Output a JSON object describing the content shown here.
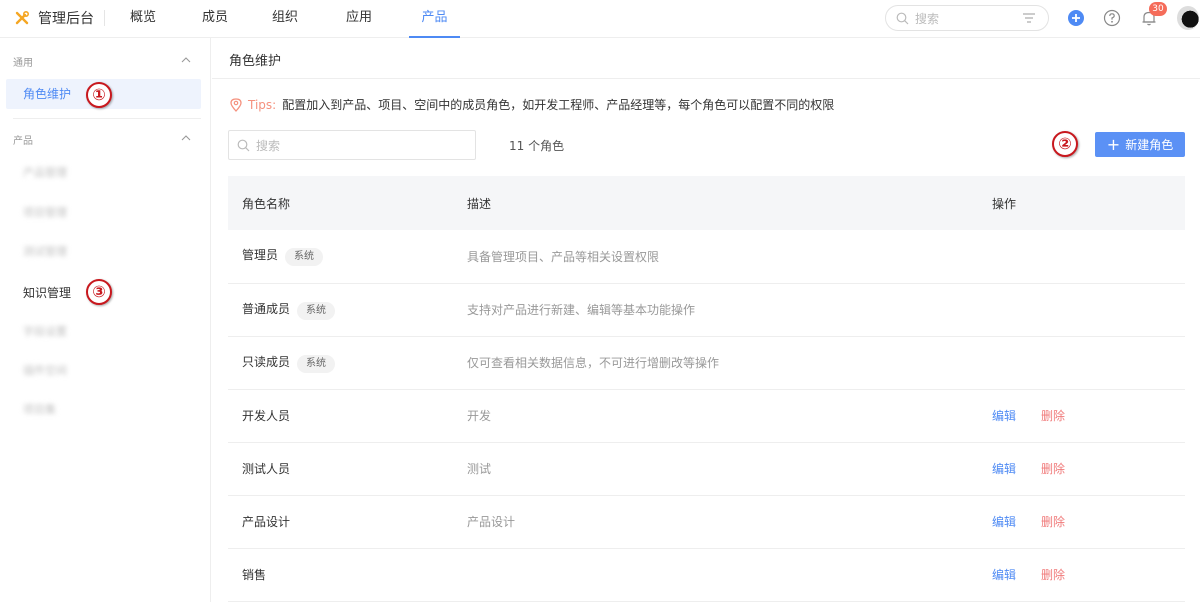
{
  "topbar": {
    "app_title": "管理后台",
    "nav": [
      "概览",
      "成员",
      "组织",
      "应用",
      "产品"
    ],
    "active_nav": "产品",
    "search_placeholder": "搜索",
    "notification_count": "30",
    "icons": [
      "tools-icon",
      "filter-icon",
      "add-circle-icon",
      "help-icon",
      "bell-icon"
    ]
  },
  "sidebar": {
    "group1_title": "通用",
    "group1_items": [
      "角色维护"
    ],
    "group2_title": "产品",
    "group2_items": [
      "产品管理",
      "项目管理",
      "测试管理",
      "知识管理",
      "字段设置",
      "插件空间",
      "项目集"
    ],
    "annotations": [
      "①",
      "②",
      "③"
    ]
  },
  "main": {
    "title": "角色维护",
    "tips_label": "Tips:",
    "tips_text": "配置加入到产品、项目、空间中的成员角色，如开发工程师、产品经理等，每个角色可以配置不同的权限",
    "search_placeholder": "搜索",
    "role_count": "11 个角色",
    "new_button": "新建角色",
    "columns": [
      "角色名称",
      "描述",
      "操作"
    ],
    "rows": [
      {
        "name": "管理员",
        "tag": "系统",
        "desc": "具备管理项目、产品等相关设置权限",
        "edit": "",
        "delete": ""
      },
      {
        "name": "普通成员",
        "tag": "系统",
        "desc": "支持对产品进行新建、编辑等基本功能操作",
        "edit": "",
        "delete": ""
      },
      {
        "name": "只读成员",
        "tag": "系统",
        "desc": "仅可查看相关数据信息，不可进行增删改等操作",
        "edit": "",
        "delete": ""
      },
      {
        "name": "开发人员",
        "tag": "",
        "desc": "开发",
        "edit": "编辑",
        "delete": "删除"
      },
      {
        "name": "测试人员",
        "tag": "",
        "desc": "测试",
        "edit": "编辑",
        "delete": "删除"
      },
      {
        "name": "产品设计",
        "tag": "",
        "desc": "产品设计",
        "edit": "编辑",
        "delete": "删除"
      },
      {
        "name": "销售",
        "tag": "",
        "desc": "",
        "edit": "编辑",
        "delete": "删除"
      }
    ]
  },
  "colors": {
    "accent": "#4e8af4",
    "danger": "#f07a7a",
    "annotation": "#c8181e"
  }
}
